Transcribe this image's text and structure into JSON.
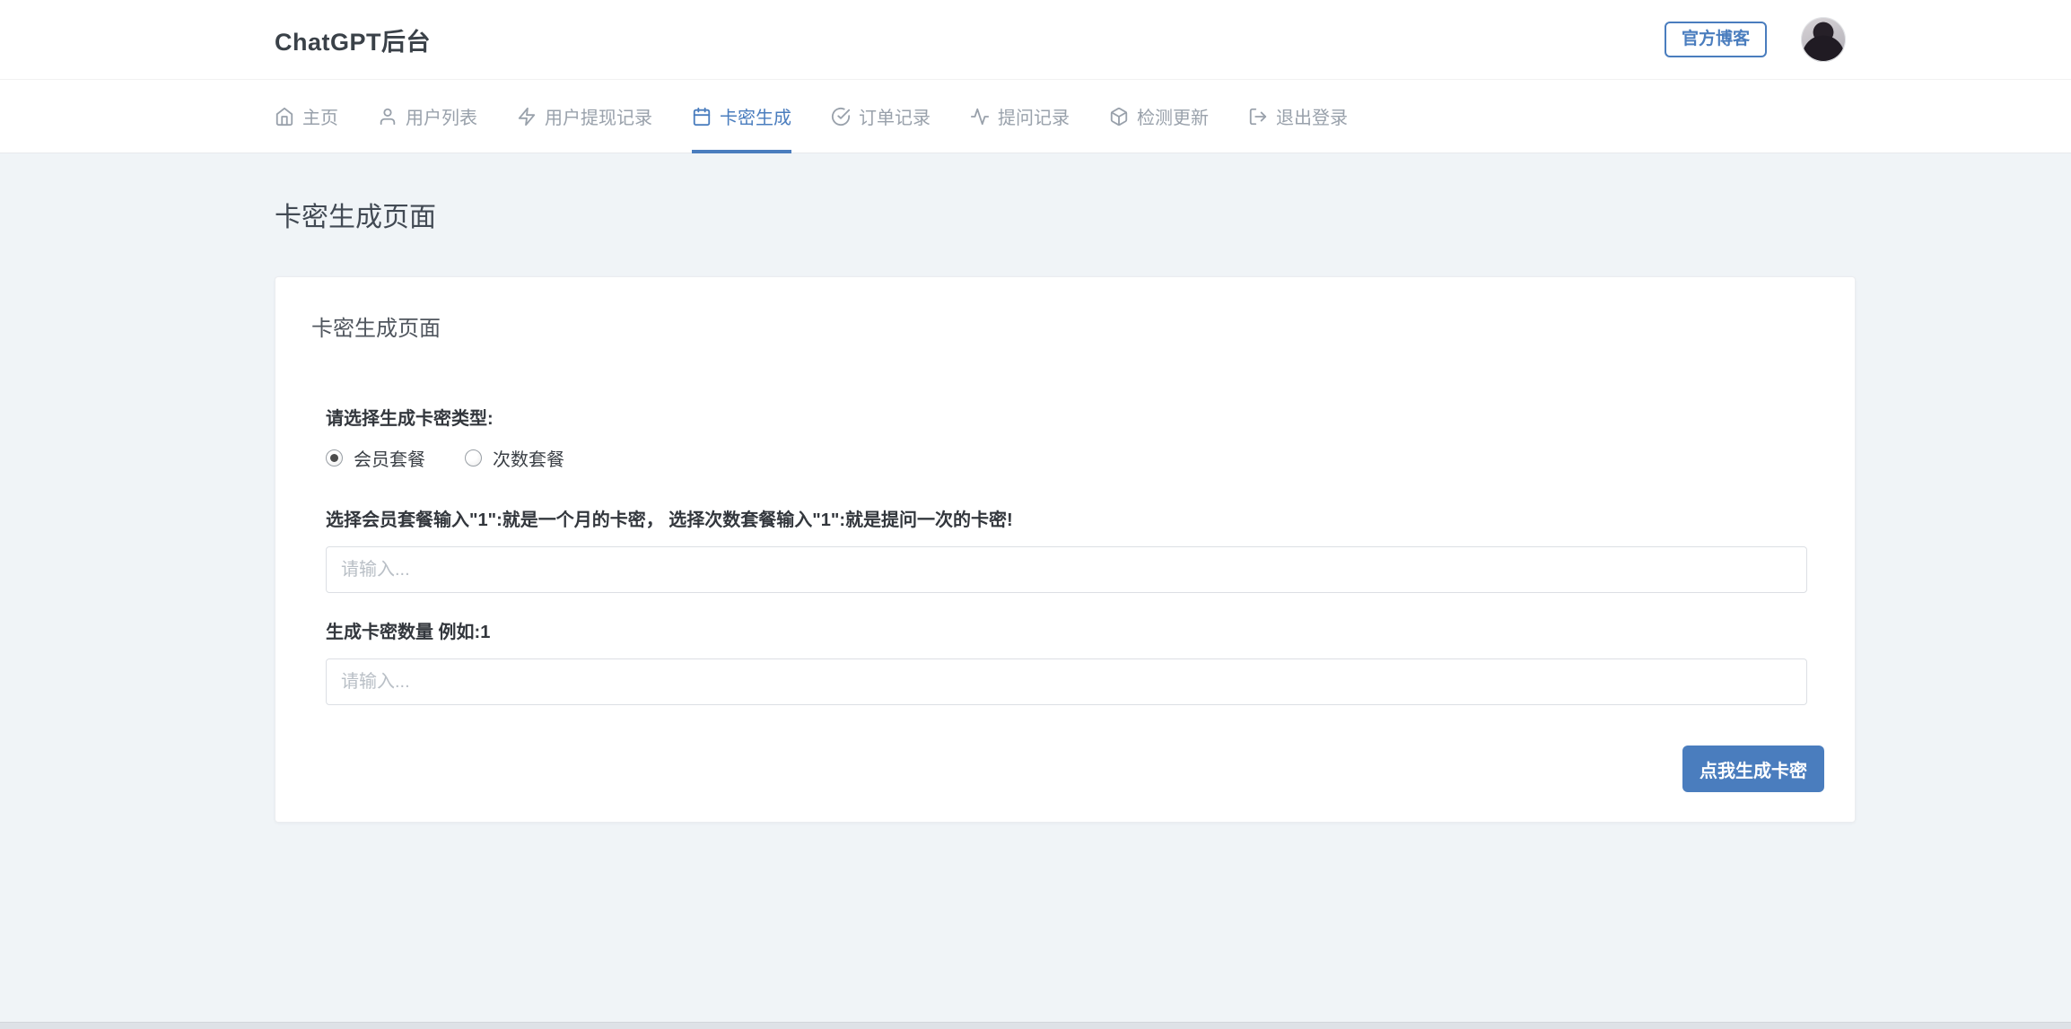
{
  "header": {
    "title": "ChatGPT后台",
    "blog_button": "官方博客"
  },
  "nav": {
    "items": [
      {
        "label": "主页",
        "icon": "home-icon",
        "active": false
      },
      {
        "label": "用户列表",
        "icon": "user-icon",
        "active": false
      },
      {
        "label": "用户提现记录",
        "icon": "zap-icon",
        "active": false
      },
      {
        "label": "卡密生成",
        "icon": "calendar-icon",
        "active": true
      },
      {
        "label": "订单记录",
        "icon": "check-circle-icon",
        "active": false
      },
      {
        "label": "提问记录",
        "icon": "activity-icon",
        "active": false
      },
      {
        "label": "检测更新",
        "icon": "package-icon",
        "active": false
      },
      {
        "label": "退出登录",
        "icon": "logout-icon",
        "active": false
      }
    ]
  },
  "page": {
    "title": "卡密生成页面"
  },
  "card": {
    "title": "卡密生成页面",
    "type_label": "请选择生成卡密类型:",
    "radios": [
      {
        "label": "会员套餐",
        "checked": true
      },
      {
        "label": "次数套餐",
        "checked": false
      }
    ],
    "hint": "选择会员套餐输入\"1\":就是一个月的卡密， 选择次数套餐输入\"1\":就是提问一次的卡密!",
    "package_input": {
      "value": "",
      "placeholder": "请输入..."
    },
    "quantity_label": "生成卡密数量 例如:1",
    "quantity_input": {
      "value": "",
      "placeholder": "请输入..."
    },
    "submit_button": "点我生成卡密"
  },
  "colors": {
    "accent": "#4a7dbe",
    "body_bg": "#f0f4f7",
    "nav_inactive": "#99a1ab"
  }
}
